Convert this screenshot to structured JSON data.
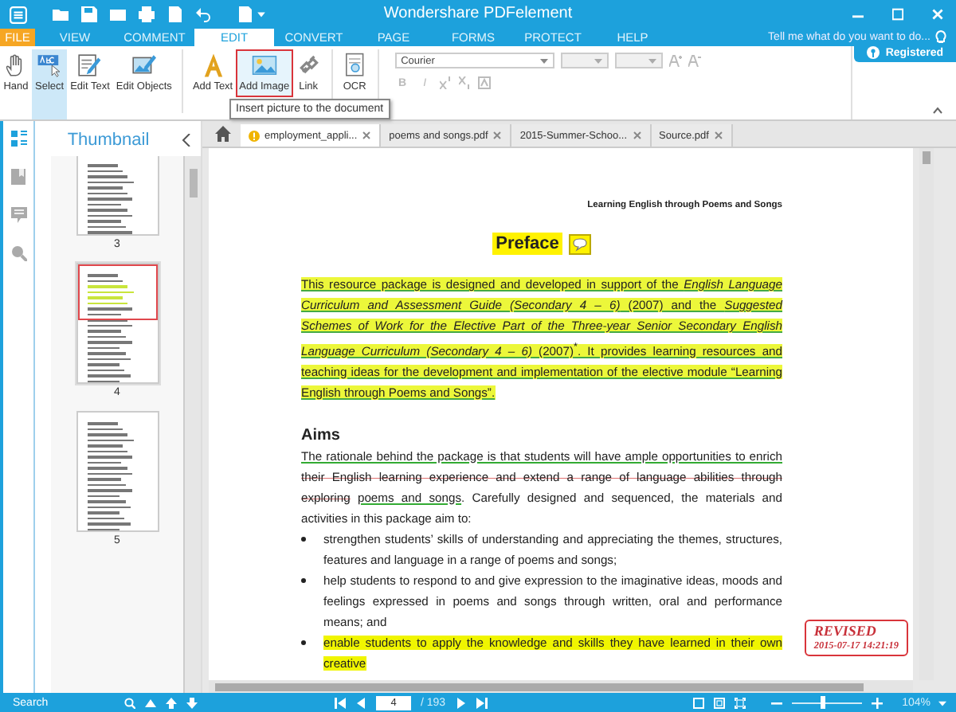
{
  "window": {
    "title": "Wondershare PDFelement"
  },
  "menu_tabs": [
    {
      "label": "FILE",
      "kind": "file",
      "selected": false
    },
    {
      "label": "VIEW",
      "kind": "tab",
      "selected": false
    },
    {
      "label": "COMMENT",
      "kind": "tab",
      "selected": false
    },
    {
      "label": "EDIT",
      "kind": "tab",
      "selected": true
    },
    {
      "label": "CONVERT",
      "kind": "tab",
      "selected": false
    },
    {
      "label": "PAGE",
      "kind": "tab",
      "selected": false
    },
    {
      "label": "FORMS",
      "kind": "tab",
      "selected": false
    },
    {
      "label": "PROTECT",
      "kind": "tab",
      "selected": false
    },
    {
      "label": "HELP",
      "kind": "tab",
      "selected": false
    }
  ],
  "tell_me": {
    "placeholder": "Tell me what do you want to do..."
  },
  "account": {
    "label": "Registered"
  },
  "ribbon": {
    "tools": [
      {
        "label": "Hand",
        "kind": "hand",
        "selected": false,
        "hovered": false
      },
      {
        "label": "Select",
        "kind": "select",
        "selected": true,
        "hovered": false
      },
      {
        "label": "Edit Text",
        "kind": "edittext",
        "selected": false,
        "hovered": false
      },
      {
        "label": "Edit Objects",
        "kind": "editobj",
        "selected": false,
        "hovered": false
      },
      {
        "label": "Add Text",
        "kind": "addtext",
        "selected": false,
        "hovered": false
      },
      {
        "label": "Add Image",
        "kind": "addimage",
        "selected": false,
        "hovered": true
      },
      {
        "label": "Link",
        "kind": "link",
        "selected": false,
        "hovered": false
      },
      {
        "label": "OCR",
        "kind": "ocr",
        "selected": false,
        "hovered": false
      }
    ],
    "font": {
      "value": "Courier"
    },
    "format_buttons": [
      "B",
      "I"
    ],
    "tooltip": "Insert picture to the document"
  },
  "sidebar": {
    "title": "Thumbnail",
    "pages": [
      {
        "label": "3",
        "selected": false
      },
      {
        "label": "4",
        "selected": true
      },
      {
        "label": "5",
        "selected": false
      }
    ]
  },
  "doc_tabs": [
    {
      "label": "employment_appli...",
      "warning": true,
      "selected": true
    },
    {
      "label": "poems and songs.pdf",
      "warning": false,
      "selected": false
    },
    {
      "label": "2015-Summer-Schoo...",
      "warning": false,
      "selected": false
    },
    {
      "label": "Source.pdf",
      "warning": false,
      "selected": false
    }
  ],
  "document": {
    "running_header": "Learning English through Poems and Songs",
    "title": "Preface",
    "intro": "This resource package is designed and developed in support of the *English Language Curriculum and Assessment Guide (Secondary 4 – 6)* (2007) and the *Suggested Schemes of Work for the Elective Part of the Three-year Senior Secondary English Language Curriculum (Secondary 4 – 6)* (2007)$^{*}$. It provides learning resources and teaching ideas for the development and implementation of the elective module “Learning English through Poems and Songs”.",
    "section": "Aims",
    "aims_paragraph": [
      {
        "text": "The rationale behind the package is that students will have ample opportunities to enrich",
        "kind": "underline"
      },
      {
        "text": "their English learning experience and extend a range of language abilities through exploring",
        "kind": "strike"
      },
      {
        "text": "poems and songs",
        "kind": "underline"
      },
      {
        "text": ". Carefully designed and sequenced, the materials and activities in this package aim to:",
        "kind": "plain"
      }
    ],
    "bullets": [
      {
        "text": "strengthen students’ skills of understanding and appreciating the themes, structures, features and language in a range of poems and songs;",
        "highlighted": false
      },
      {
        "text": "help students to respond to and give expression to the imaginative ideas, moods and feelings expressed in poems and songs through written, oral and performance means; and",
        "highlighted": false
      },
      {
        "text": "enable students to apply the knowledge and skills they have learned in their own creative",
        "highlighted": true
      }
    ],
    "stamp": {
      "title": "REVISED",
      "date": "2015-07-17 14:21:19"
    }
  },
  "status_bar": {
    "search_label": "Search",
    "page": "4",
    "page_total": "/ 193",
    "zoom": {
      "level": 0.45,
      "reading": "104%"
    }
  }
}
